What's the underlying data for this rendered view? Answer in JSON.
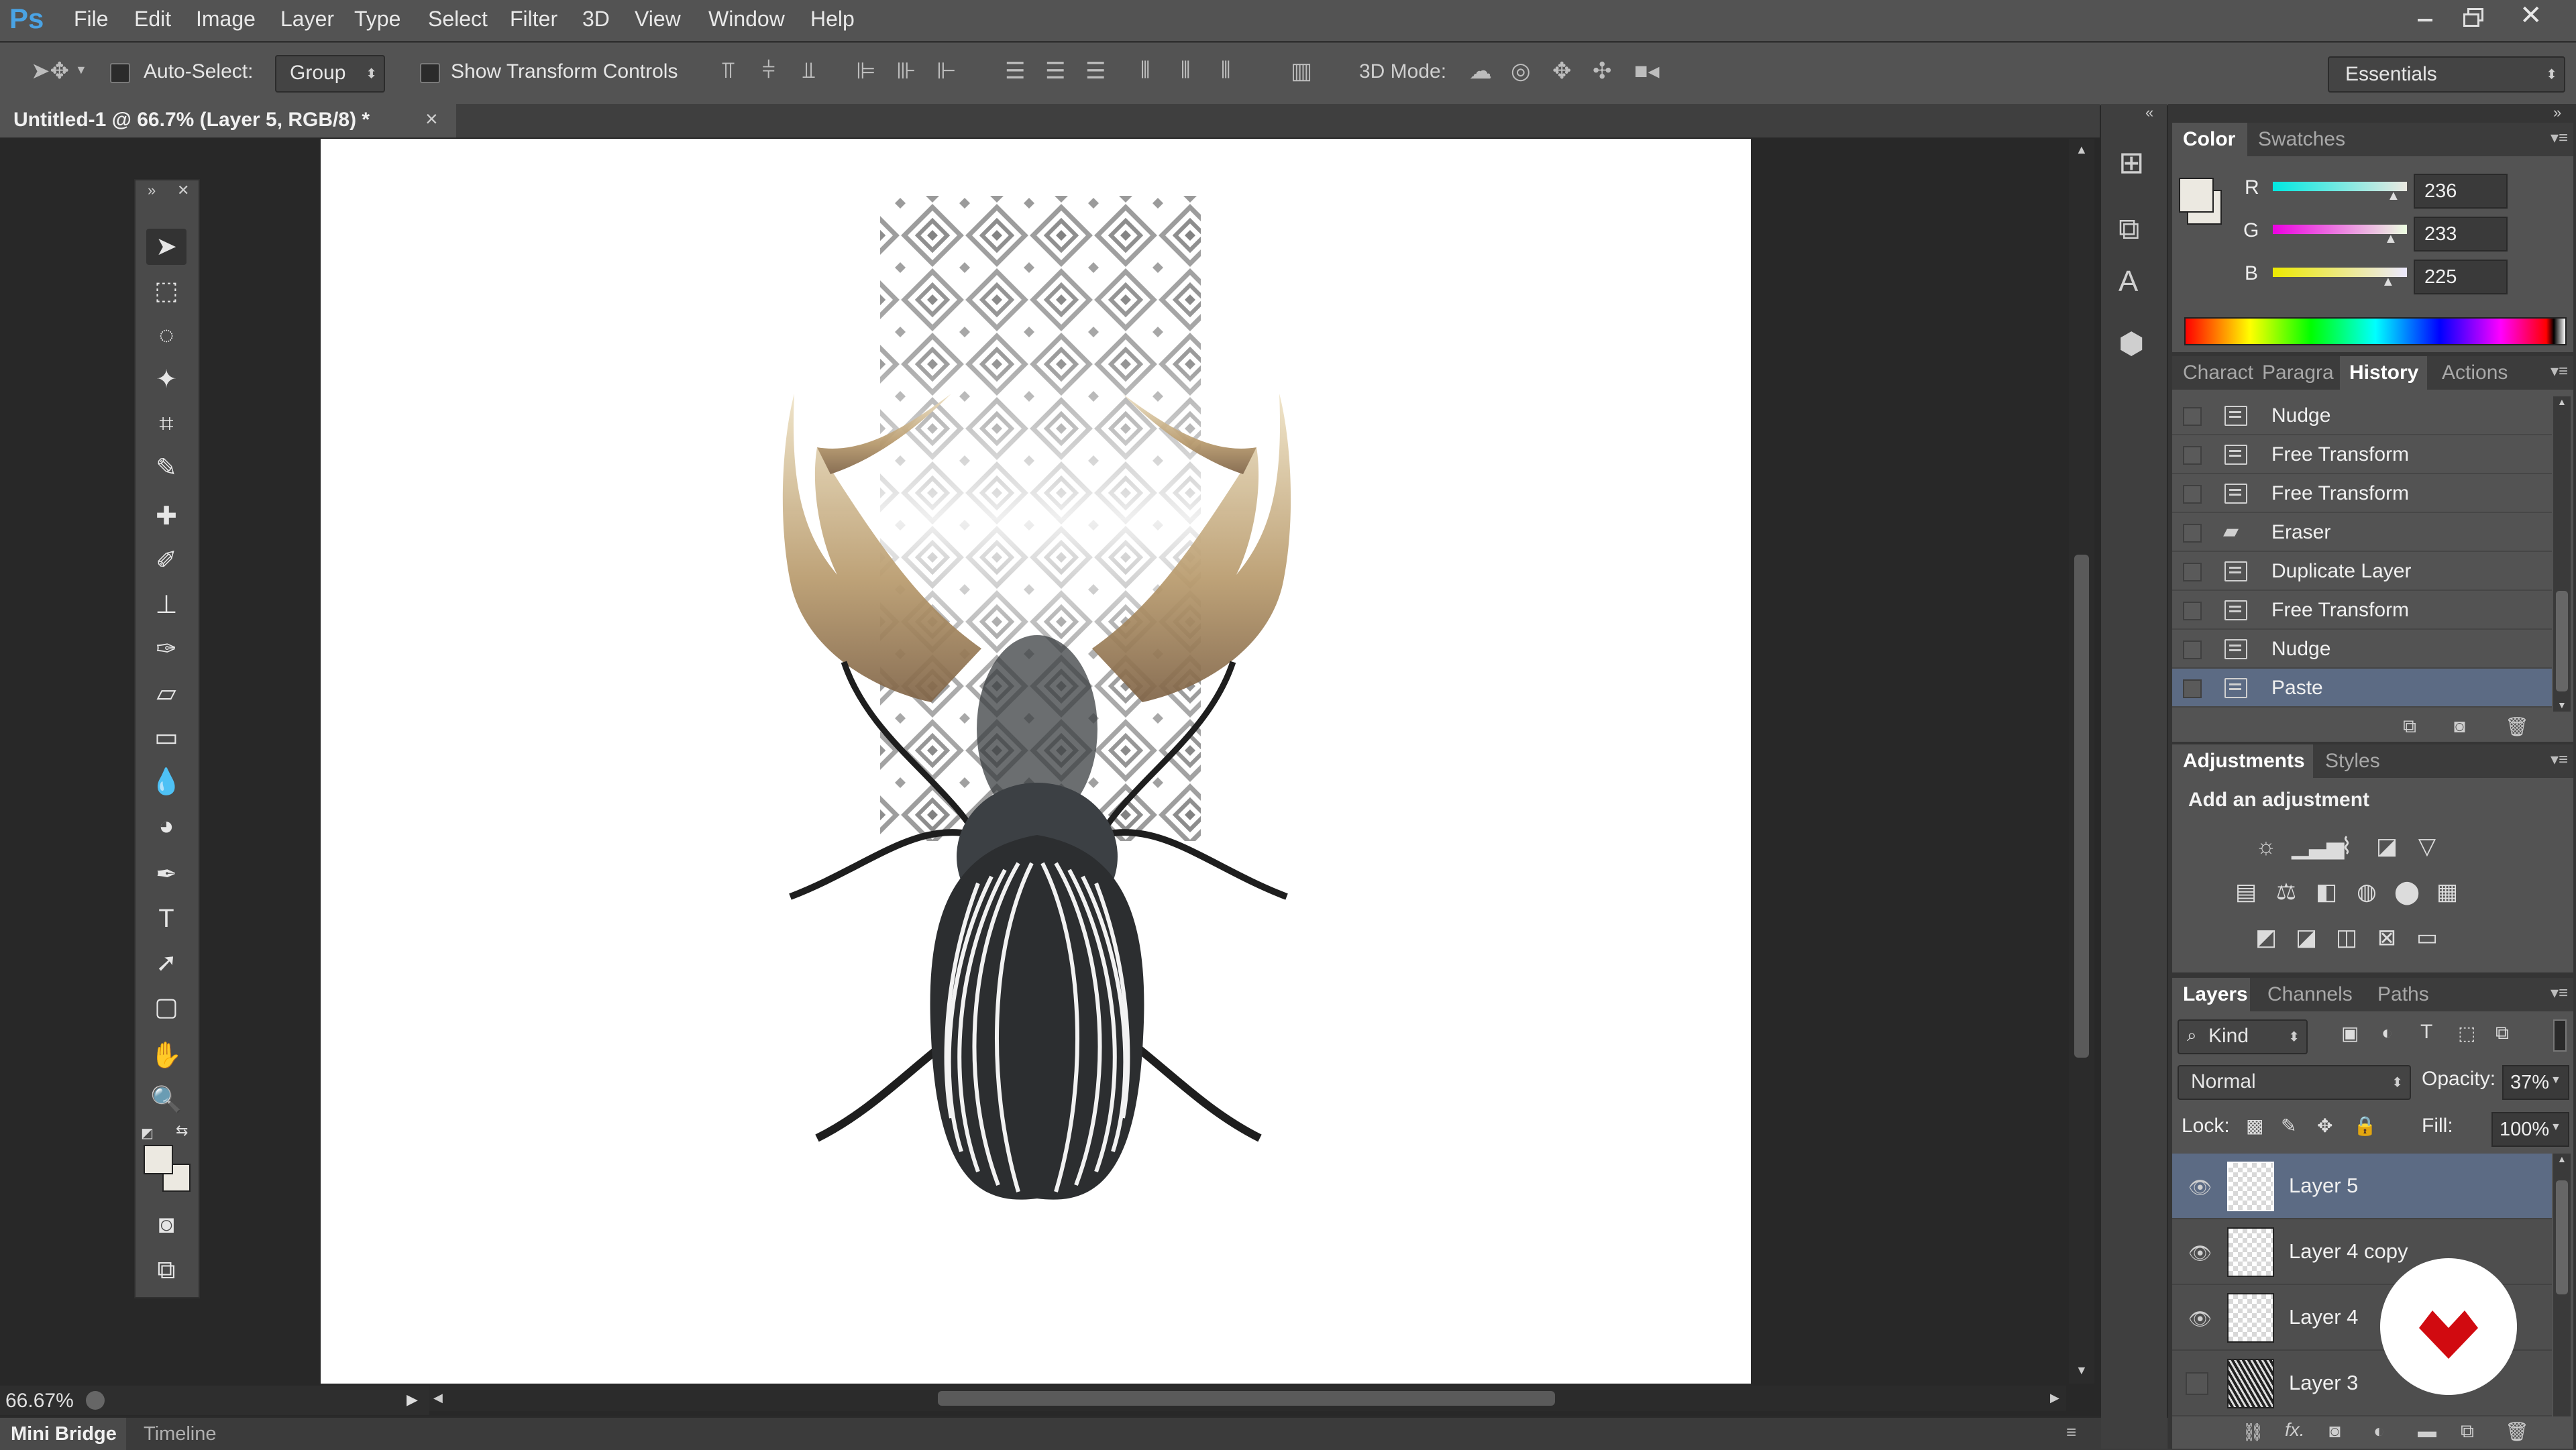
{
  "app": {
    "logo": "Ps"
  },
  "menu": [
    "File",
    "Edit",
    "Image",
    "Layer",
    "Type",
    "Select",
    "Filter",
    "3D",
    "View",
    "Window",
    "Help"
  ],
  "window_controls": [
    "minimize-icon",
    "restore-icon",
    "close-icon"
  ],
  "options": {
    "auto_select_label": "Auto-Select:",
    "auto_select_value": "Group",
    "show_transform_label": "Show Transform Controls",
    "mode_3d_label": "3D Mode:",
    "workspace": "Essentials"
  },
  "document": {
    "tab_title": "Untitled-1 @ 66.7% (Layer 5, RGB/8) *",
    "close": "×"
  },
  "status": {
    "zoom": "66.67%"
  },
  "bottom_tabs": [
    "Mini Bridge",
    "Timeline"
  ],
  "color_panel": {
    "tabs": [
      "Color",
      "Swatches"
    ],
    "r_label": "R",
    "g_label": "G",
    "b_label": "B",
    "r": "236",
    "g": "233",
    "b": "225",
    "foreground": "#ece9e1"
  },
  "history_panel": {
    "tabs": [
      "Charact",
      "Paragra",
      "History",
      "Actions"
    ],
    "items": [
      "Nudge",
      "Free Transform",
      "Free Transform",
      "Eraser",
      "Duplicate Layer",
      "Free Transform",
      "Nudge",
      "Paste"
    ],
    "selected": "Paste"
  },
  "adjustments_panel": {
    "tabs": [
      "Adjustments",
      "Styles"
    ],
    "title": "Add an adjustment"
  },
  "layers_panel": {
    "tabs": [
      "Layers",
      "Channels",
      "Paths"
    ],
    "filter": "Kind",
    "blend_mode": "Normal",
    "opacity_label": "Opacity:",
    "opacity": "37%",
    "lock_label": "Lock:",
    "fill_label": "Fill:",
    "fill": "100%",
    "layers": [
      {
        "name": "Layer 5",
        "visible": true,
        "selected": true
      },
      {
        "name": "Layer 4 copy",
        "visible": true,
        "selected": false
      },
      {
        "name": "Layer 4",
        "visible": true,
        "selected": false
      },
      {
        "name": "Layer 3",
        "visible": false,
        "selected": false
      }
    ]
  },
  "colors": {
    "accent_selection": "#5c6b84",
    "watermark": "#d10a10"
  }
}
